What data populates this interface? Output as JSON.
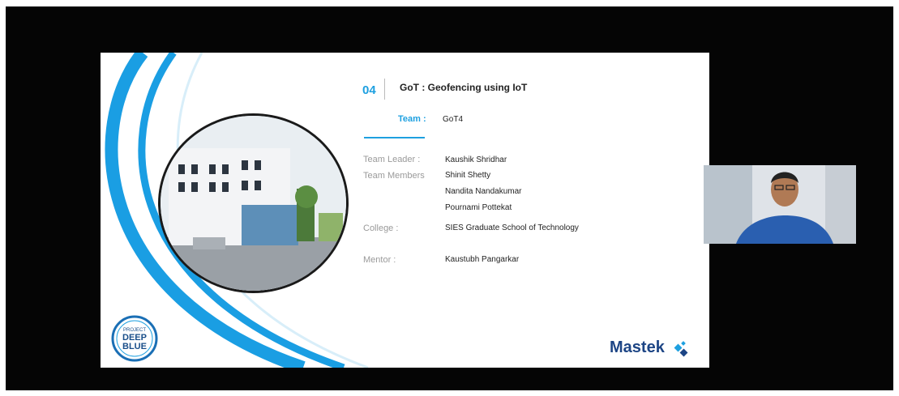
{
  "slide": {
    "number": "04",
    "title": "GoT : Geofencing using IoT",
    "team_label": "Team :",
    "team_name": "GoT4",
    "rows": [
      {
        "label": "Team Leader :",
        "values": [
          "Kaushik Shridhar"
        ]
      },
      {
        "label": "Team Members",
        "values": [
          "Shinit Shetty",
          "Nandita Nandakumar",
          "Pournami Pottekat"
        ]
      },
      {
        "label": "College :",
        "values": [
          "SIES Graduate School of Technology"
        ]
      },
      {
        "label": "Mentor :",
        "values": [
          "Kaustubh Pangarkar"
        ]
      }
    ],
    "badge_lines": [
      "PROJECT",
      "DEEP",
      "BLUE"
    ],
    "brand": "Mastek",
    "colors": {
      "accent": "#1ea0e0",
      "brand": "#1d4585",
      "background": "#050505"
    }
  },
  "video": {
    "participant_icon": "person-video-icon"
  }
}
